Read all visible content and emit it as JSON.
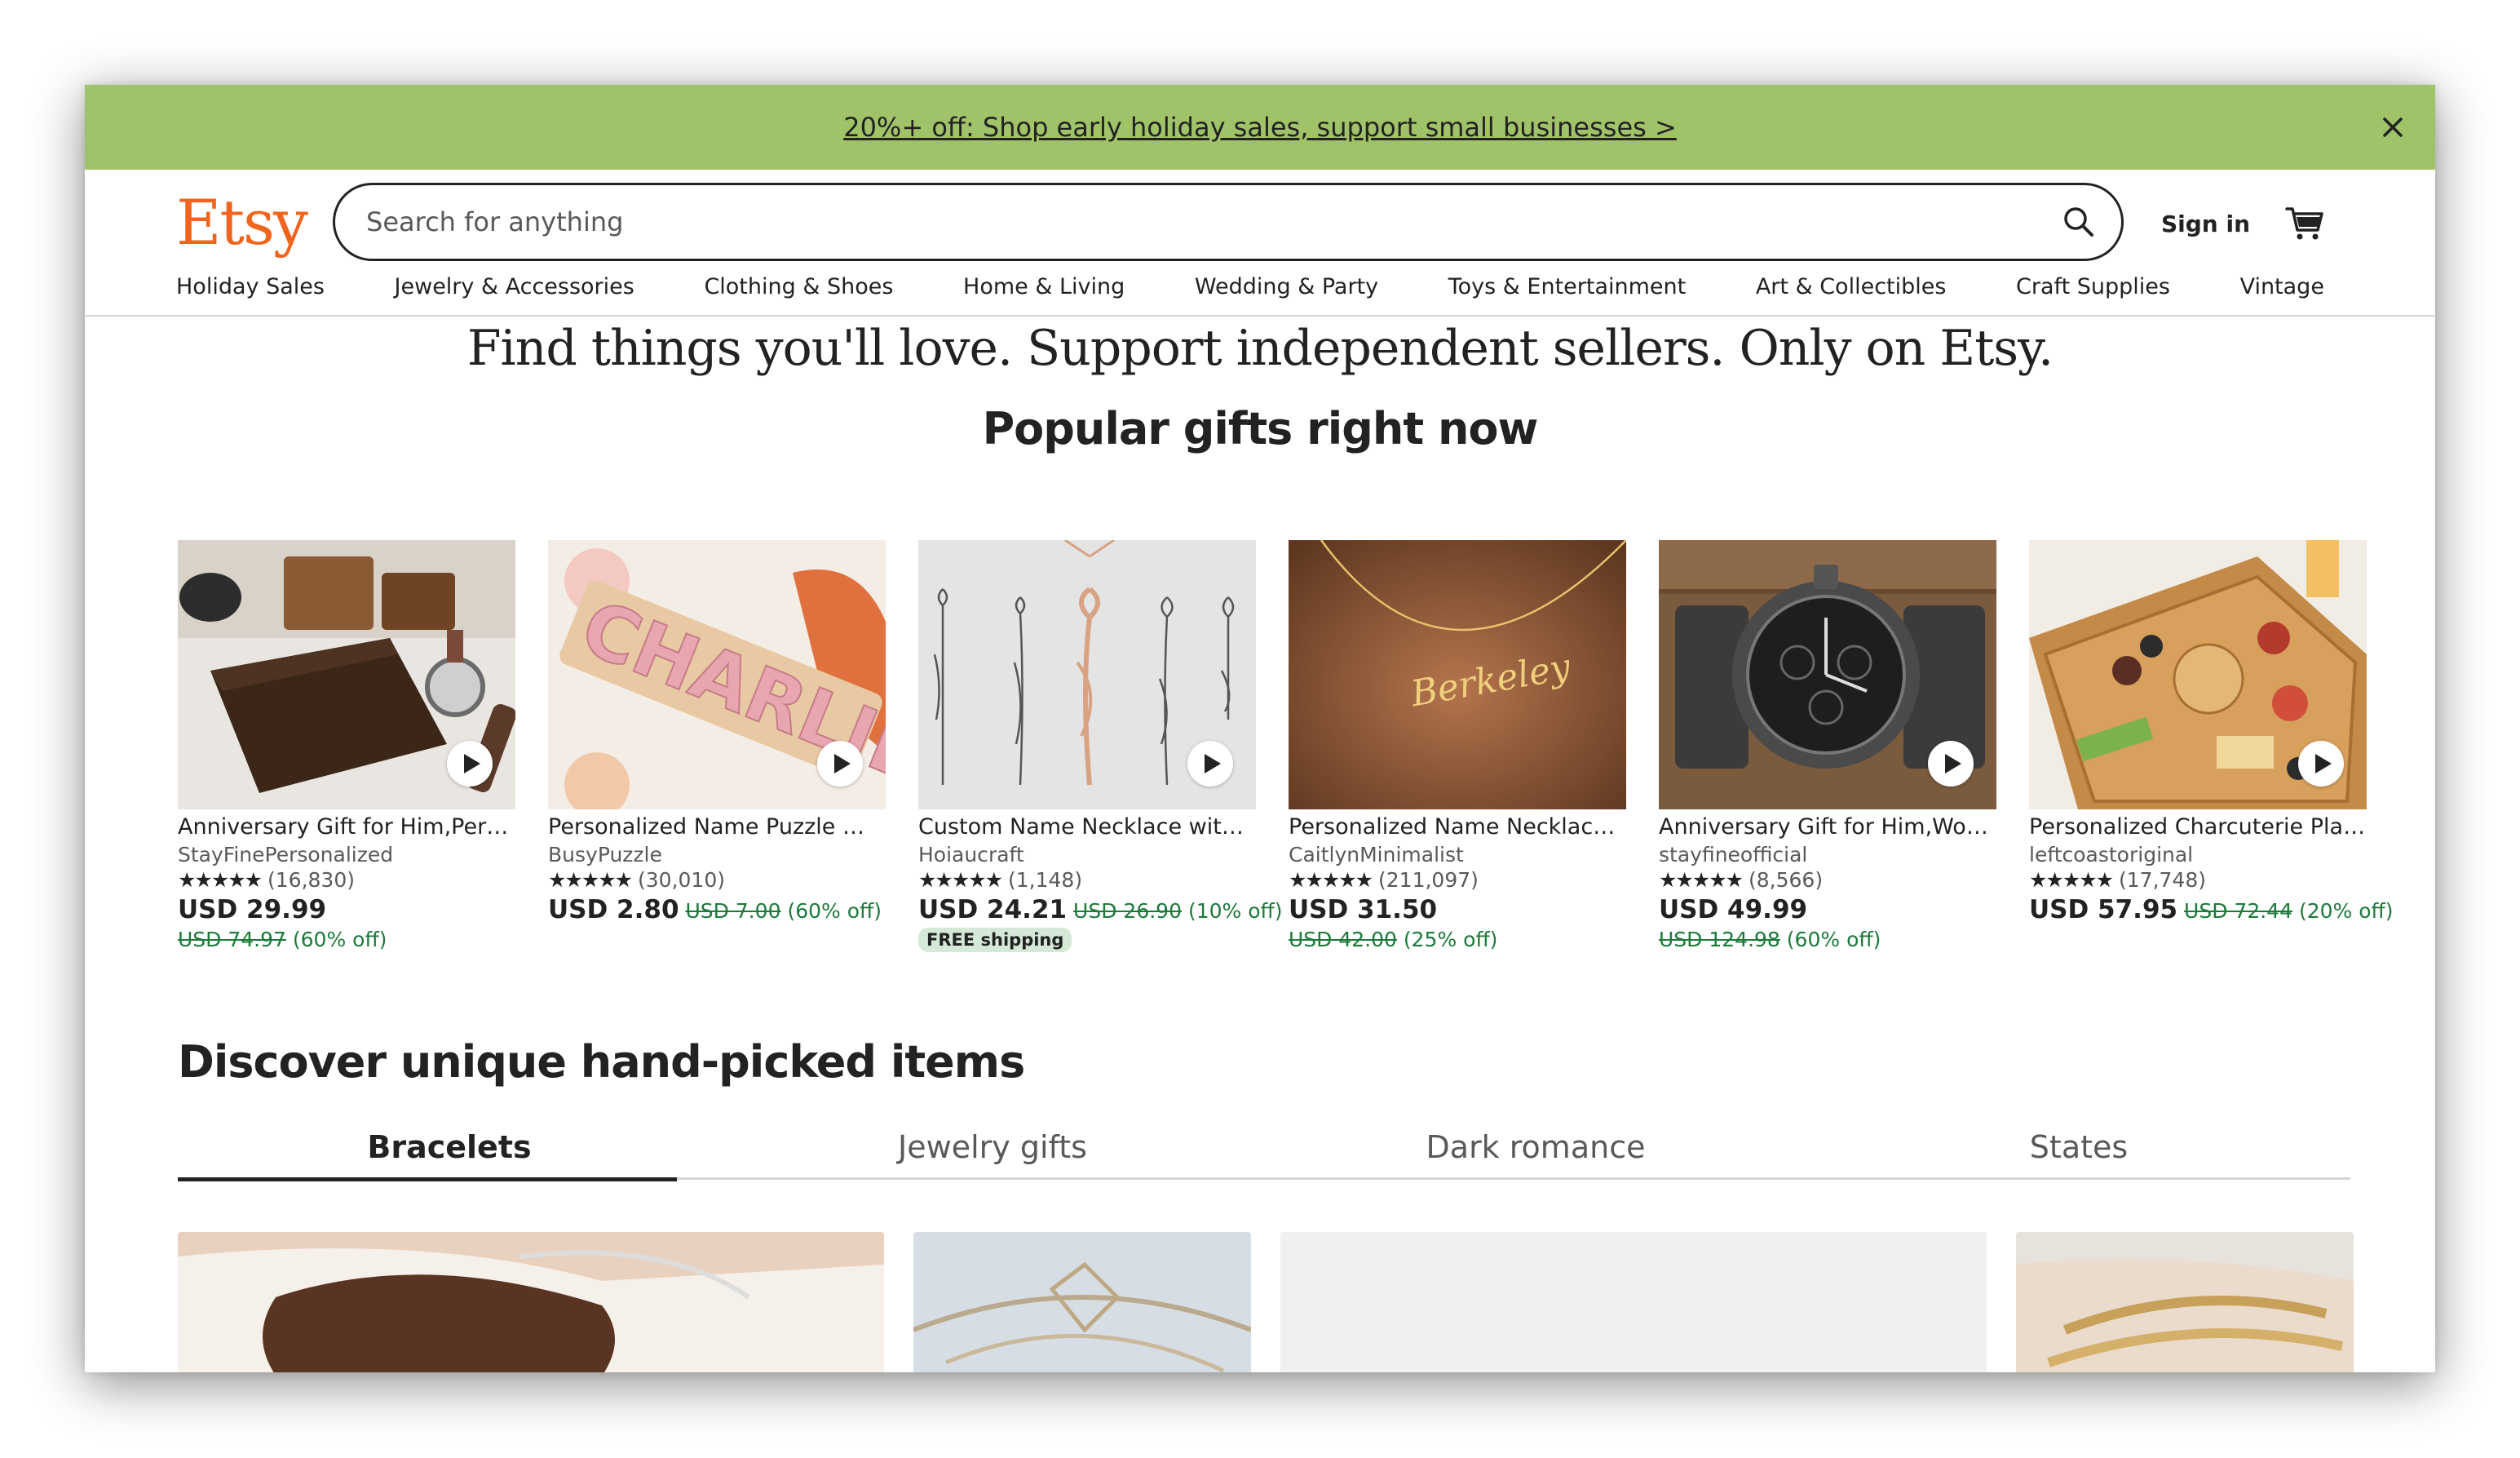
{
  "promo": {
    "text": "20%+ off: Shop early holiday sales, support small businesses >"
  },
  "header": {
    "logo": "Etsy",
    "search_placeholder": "Search for anything",
    "signin": "Sign in"
  },
  "nav": [
    "Holiday Sales",
    "Jewelry & Accessories",
    "Clothing & Shoes",
    "Home & Living",
    "Wedding & Party",
    "Toys & Entertainment",
    "Art & Collectibles",
    "Craft Supplies",
    "Vintage"
  ],
  "hero": {
    "tagline": "Find things you'll love. Support independent sellers. Only on Etsy."
  },
  "popular": {
    "title": "Popular gifts right now",
    "products": [
      {
        "title": "Anniversary Gift for Him,Personalized Leather Wallet",
        "shop": "StayFinePersonalized",
        "stars": "★★★★★",
        "reviews": "(16,830)",
        "price": "USD 29.99",
        "original": "USD 74.97",
        "discount": "(60% off)",
        "free_shipping": ""
      },
      {
        "title": "Personalized Name Puzzle With Pegs",
        "shop": "BusyPuzzle",
        "stars": "★★★★★",
        "reviews": "(30,010)",
        "price": "USD 2.80",
        "original": "USD 7.00",
        "discount": "(60% off)",
        "free_shipping": ""
      },
      {
        "title": "Custom Name Necklace with Birth Flower",
        "shop": "Hoiaucraft",
        "stars": "★★★★★",
        "reviews": "(1,148)",
        "price": "USD 24.21",
        "original": "USD 26.90",
        "discount": "(10% off)",
        "free_shipping": "FREE shipping"
      },
      {
        "title": "Personalized Name Necklace Gold",
        "shop": "CaitlynMinimalist",
        "stars": "★★★★★",
        "reviews": "(211,097)",
        "price": "USD 31.50",
        "original": "USD 42.00",
        "discount": "(25% off)",
        "free_shipping": ""
      },
      {
        "title": "Anniversary Gift for Him,Wooden Watch",
        "shop": "stayfineofficial",
        "stars": "★★★★★",
        "reviews": "(8,566)",
        "price": "USD 49.99",
        "original": "USD 124.98",
        "discount": "(60% off)",
        "free_shipping": ""
      },
      {
        "title": "Personalized Charcuterie Platter Board",
        "shop": "leftcoastoriginal",
        "stars": "★★★★★",
        "reviews": "(17,748)",
        "price": "USD 57.95",
        "original": "USD 72.44",
        "discount": "(20% off)",
        "free_shipping": ""
      }
    ]
  },
  "discover": {
    "title": "Discover unique hand-picked items",
    "tabs": [
      "Bracelets",
      "Jewelry gifts",
      "Dark romance",
      "States"
    ]
  },
  "colors": {
    "promo_bg": "#a0c36a",
    "brand": "#f1641e",
    "discount": "#1c7a3a"
  },
  "icons": {
    "close": "close-icon",
    "search": "search-icon",
    "cart": "cart-icon",
    "play": "play-icon"
  }
}
